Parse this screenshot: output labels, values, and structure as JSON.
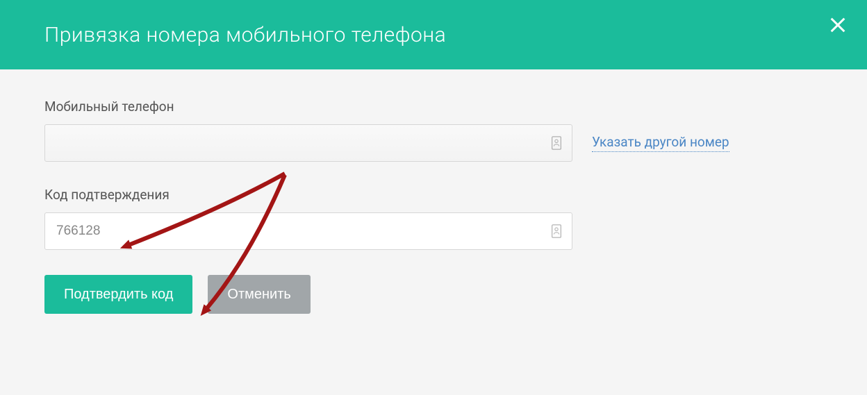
{
  "header": {
    "title": "Привязка номера мобильного телефона"
  },
  "fields": {
    "phone": {
      "label": "Мобильный телефон",
      "value": ""
    },
    "code": {
      "label": "Код подтверждения",
      "value": "766128"
    }
  },
  "links": {
    "other_number": "Указать другой номер"
  },
  "buttons": {
    "confirm": "Подтвердить код",
    "cancel": "Отменить"
  },
  "colors": {
    "accent": "#1bbc9b",
    "link": "#4a86c5",
    "secondary": "#a1a6a9",
    "arrow": "#a31515"
  }
}
